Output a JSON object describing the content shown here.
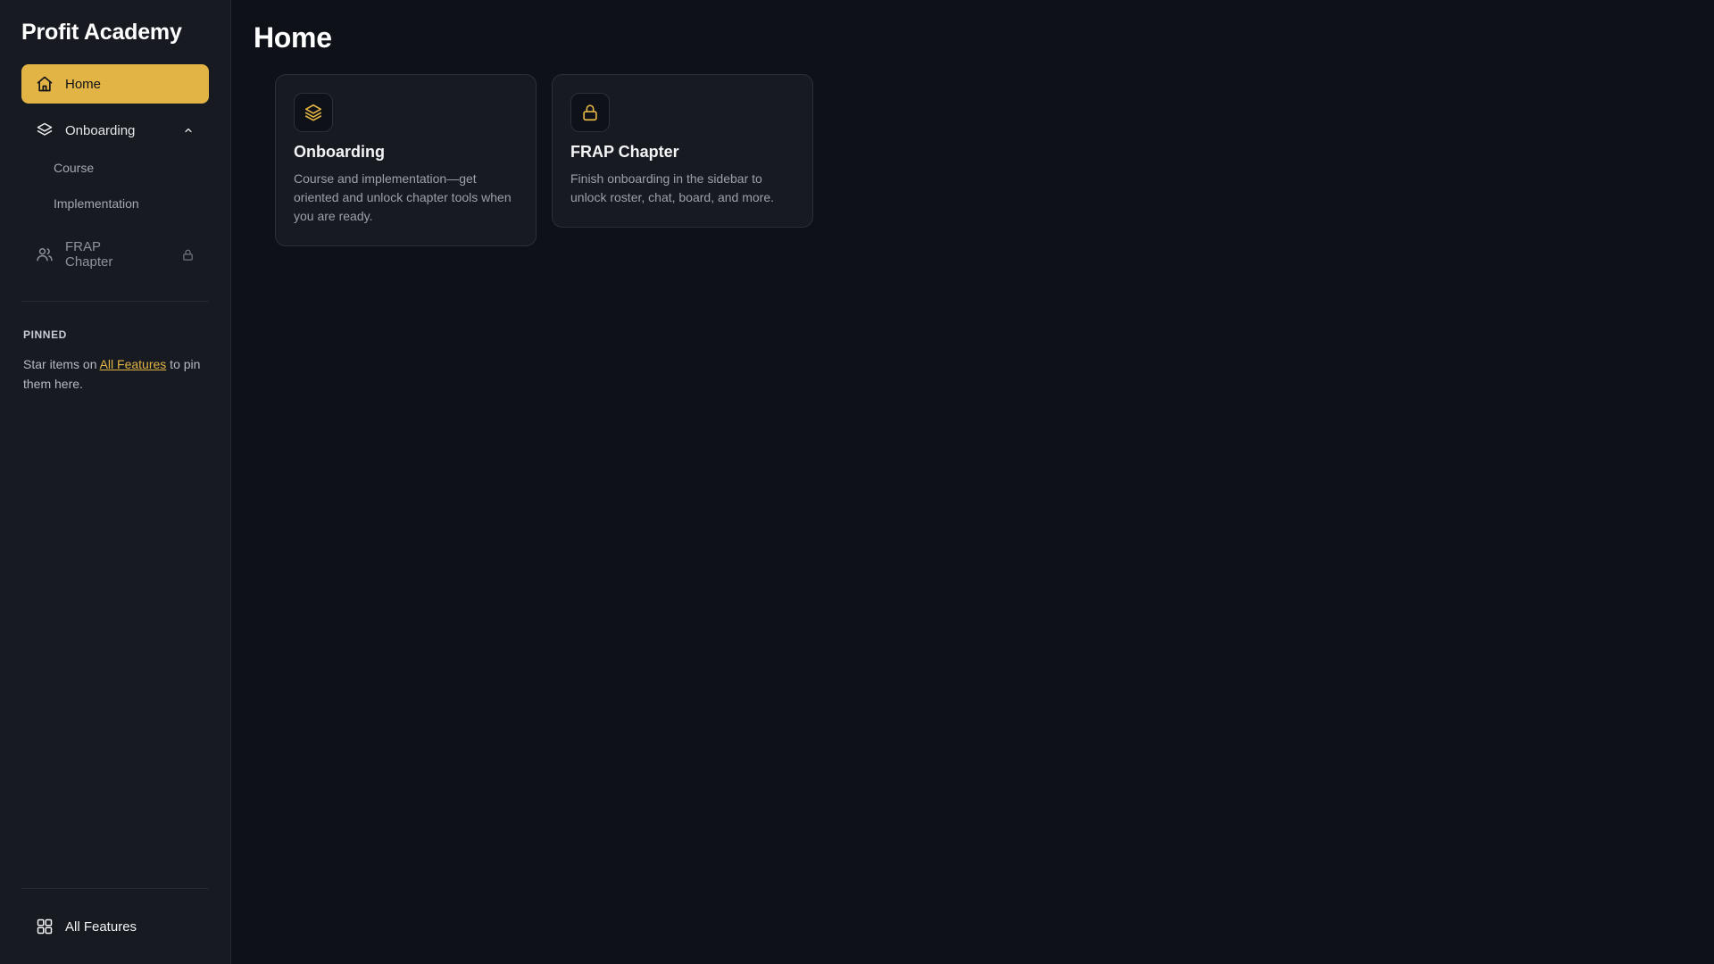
{
  "app": {
    "title": "Profit Academy"
  },
  "colors": {
    "accent": "#e2b445",
    "background": "#0e1117",
    "sidebar": "#171a21"
  },
  "sidebar": {
    "items": [
      {
        "label": "Home",
        "icon": "home-icon",
        "active": true
      },
      {
        "label": "Onboarding",
        "icon": "layers-icon",
        "expanded": true,
        "children": [
          {
            "label": "Course"
          },
          {
            "label": "Implementation"
          }
        ]
      },
      {
        "label": "FRAP Chapter",
        "icon": "users-icon",
        "locked": true
      }
    ],
    "pinned": {
      "title": "PINNED",
      "text_before": "Star items on ",
      "link": "All Features",
      "text_after": " to pin them here."
    },
    "bottom": {
      "label": "All Features",
      "icon": "grid-icon"
    }
  },
  "main": {
    "title": "Home",
    "cards": [
      {
        "title": "Onboarding",
        "icon": "layers-icon",
        "description": "Course and implementation—get oriented and unlock chapter tools when you are ready."
      },
      {
        "title": "FRAP Chapter",
        "icon": "lock-icon",
        "description": "Finish onboarding in the sidebar to unlock roster, chat, board, and more."
      }
    ]
  }
}
